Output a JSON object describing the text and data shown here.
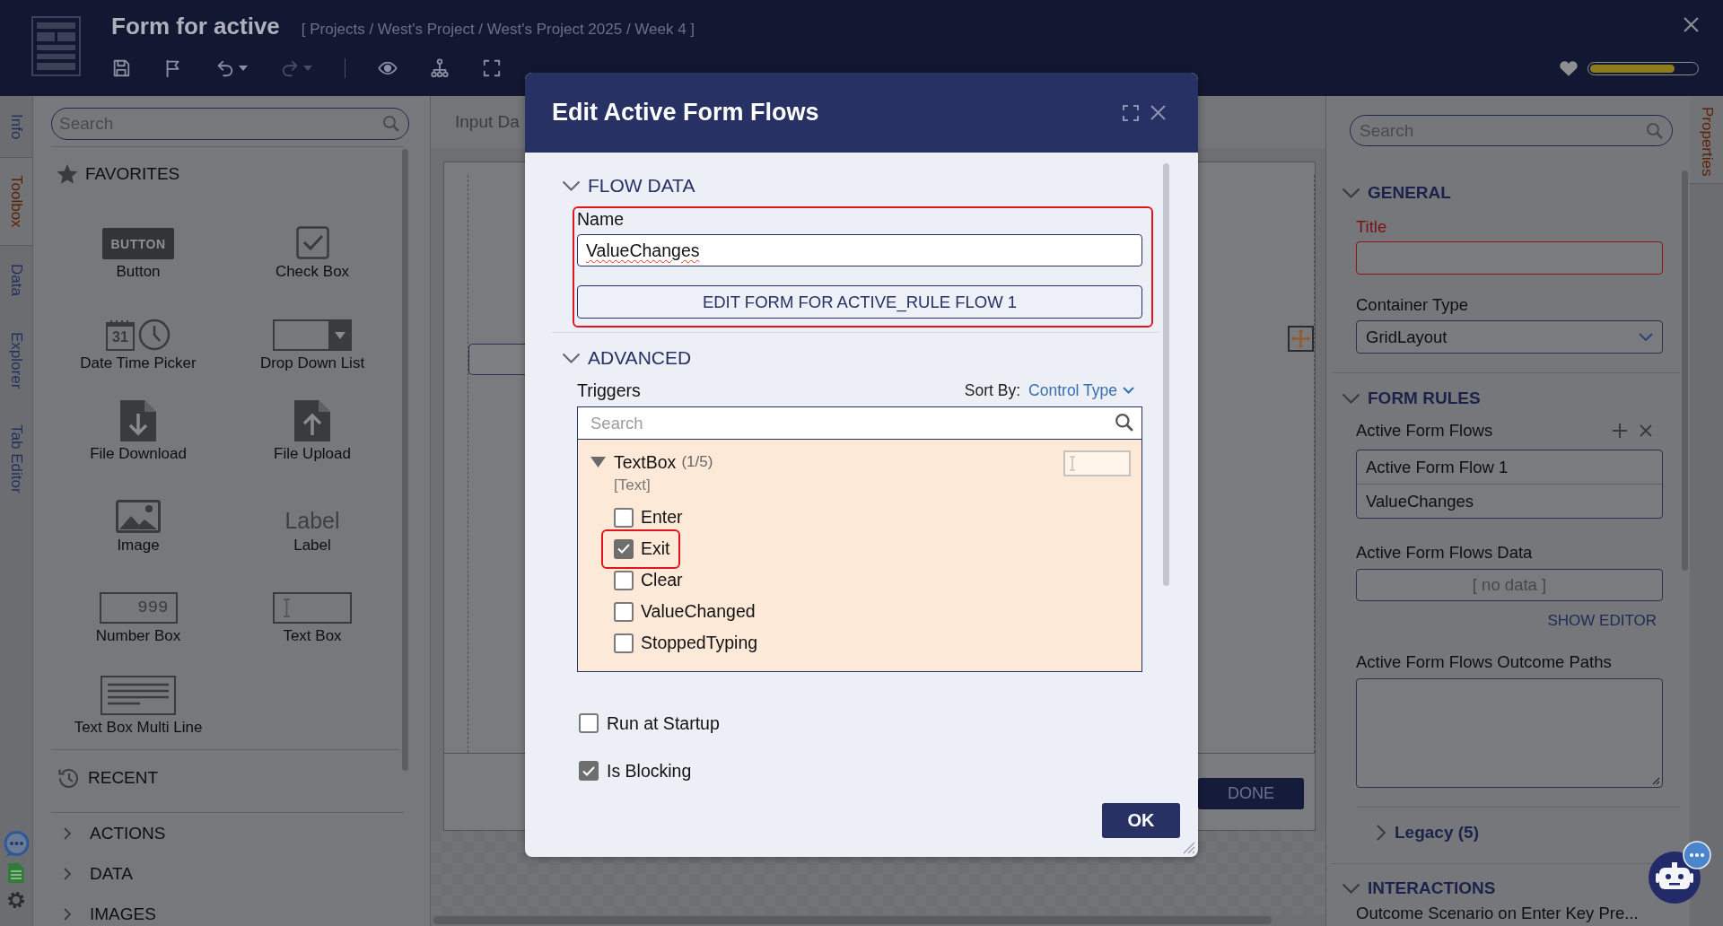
{
  "header": {
    "title": "Form for active",
    "breadcrumb": "[ Projects / West's Project / West's Project 2025 / Week 4 ]",
    "progress": {
      "level": 0.8
    }
  },
  "toolbar": [
    [
      {
        "kind": "save",
        "disabled": false,
        "menu": false
      },
      {
        "kind": "flag",
        "disabled": false,
        "menu": false
      },
      {
        "kind": "undo",
        "disabled": false,
        "menu": true
      },
      {
        "kind": "redo",
        "disabled": true,
        "menu": true
      }
    ],
    [
      {
        "kind": "preview",
        "disabled": false,
        "menu": false
      },
      {
        "kind": "hierarchy",
        "disabled": false,
        "menu": false
      },
      {
        "kind": "fullscreen",
        "disabled": false,
        "menu": false
      }
    ]
  ],
  "side_tabs": [
    {
      "label": "Info",
      "selected": false
    },
    {
      "label": "Toolbox",
      "selected": true
    },
    {
      "label": "Data",
      "selected": false
    },
    {
      "label": "Explorer",
      "selected": false
    },
    {
      "label": "Tab Editor",
      "selected": false
    }
  ],
  "toolbox": {
    "search": {
      "placeholder": "Search"
    },
    "favorites": {
      "title": "FAVORITES",
      "rows": [
        [
          {
            "kind": "button",
            "label": "Button",
            "icon_text": "BUTTON"
          },
          {
            "kind": "checkbox",
            "label": "Check Box"
          }
        ],
        [
          {
            "kind": "datetime",
            "label": "Date Time Picker",
            "icon_text": "31"
          },
          {
            "kind": "dropdown",
            "label": "Drop Down List"
          }
        ],
        [
          {
            "kind": "download",
            "label": "File Download"
          },
          {
            "kind": "upload",
            "label": "File Upload"
          }
        ],
        [
          {
            "kind": "image",
            "label": "Image"
          },
          {
            "kind": "label",
            "label": "Label",
            "icon_text": "Label"
          }
        ],
        [
          {
            "kind": "number",
            "label": "Number Box",
            "icon_text": "999"
          },
          {
            "kind": "textbox",
            "label": "Text Box"
          }
        ],
        [
          {
            "kind": "multiline",
            "label": "Text Box Multi Line"
          }
        ]
      ]
    },
    "recent": {
      "title": "RECENT"
    },
    "groups": [
      {
        "label": "ACTIONS",
        "expanded": false
      },
      {
        "label": "DATA",
        "expanded": false
      },
      {
        "label": "IMAGES",
        "expanded": false
      }
    ]
  },
  "canvas": {
    "tab_label": "Input Da",
    "done_button": "DONE"
  },
  "properties": {
    "tab": {
      "label": "Properties",
      "selected": true
    },
    "search": {
      "placeholder": "Search"
    },
    "general": {
      "title": "GENERAL",
      "expanded": true,
      "title_field": {
        "label": "Title",
        "invalid": true
      },
      "container_type": {
        "label": "Container Type",
        "value": "GridLayout"
      }
    },
    "form_rules": {
      "title": "FORM RULES",
      "expanded": true,
      "flows_label": "Active Form Flows",
      "flows": [
        "Active Form Flow 1",
        "ValueChanges"
      ],
      "data_label": "Active Form Flows Data",
      "data_value": "[ no data ]",
      "show_editor": "SHOW EDITOR",
      "outcome_label": "Active Form Flows Outcome Paths",
      "legacy": {
        "label": "Legacy (5)",
        "expanded": false
      }
    },
    "interactions": {
      "title": "INTERACTIONS",
      "expanded": true,
      "first_item": "Outcome Scenario on Enter Key Pre..."
    }
  },
  "modal": {
    "title": "Edit Active Form Flows",
    "flow_data": {
      "title": "FLOW DATA",
      "expanded": true,
      "highlighted": true,
      "name_label": "Name",
      "name_value": "ValueChanges",
      "edit_button": "EDIT FORM FOR ACTIVE_RULE FLOW 1"
    },
    "advanced": {
      "title": "ADVANCED",
      "expanded": true,
      "triggers_label": "Triggers",
      "sort_label": "Sort By:",
      "sort_value": "Control Type",
      "search": {
        "placeholder": "Search"
      },
      "tree": [
        {
          "label": "TextBox",
          "count": "(1/5)",
          "type": "[Text]",
          "expanded": true,
          "children": [
            {
              "label": "Enter",
              "checked": false,
              "highlighted": false
            },
            {
              "label": "Exit",
              "checked": true,
              "highlighted": true
            },
            {
              "label": "Clear",
              "checked": false,
              "highlighted": false
            },
            {
              "label": "ValueChanged",
              "checked": false,
              "highlighted": false
            },
            {
              "label": "StoppedTyping",
              "checked": false,
              "highlighted": false
            }
          ]
        }
      ]
    },
    "options": [
      {
        "label": "Run at Startup",
        "checked": false
      },
      {
        "label": "Is Blocking",
        "checked": true
      }
    ],
    "ok_button": "OK"
  }
}
